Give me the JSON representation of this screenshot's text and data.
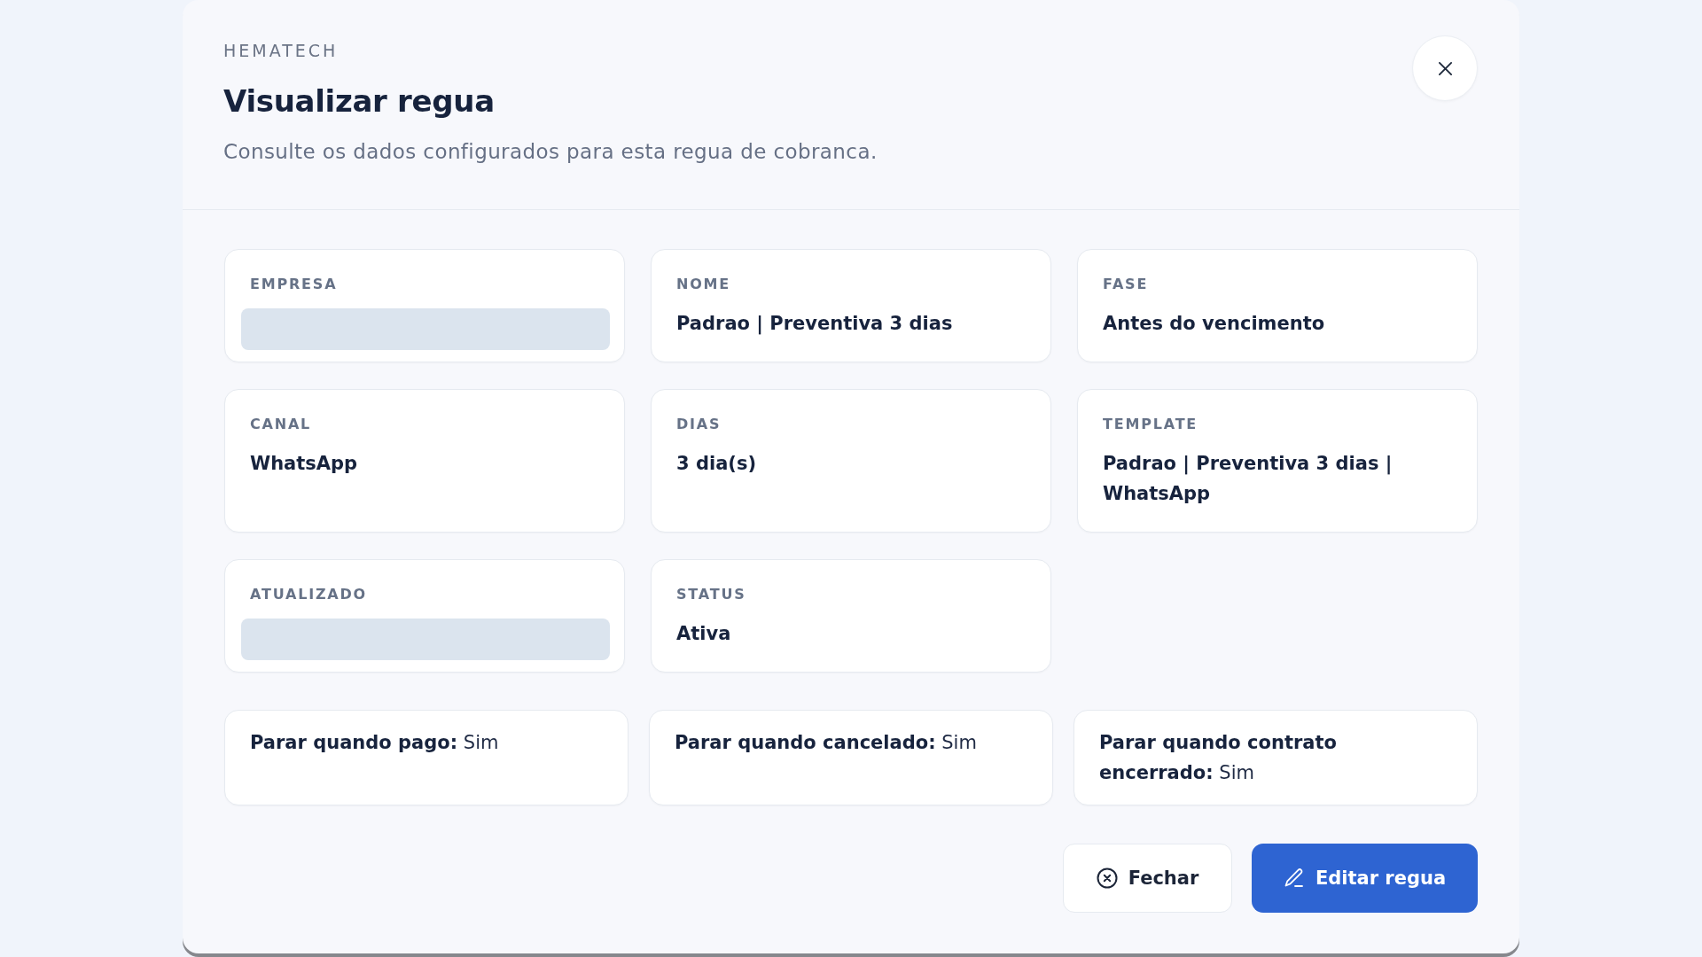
{
  "header": {
    "brand": "HEMATECH",
    "title": "Visualizar regua",
    "subtitle": "Consulte os dados configurados para esta regua de cobranca."
  },
  "fields": [
    {
      "kind": "masked",
      "label": "EMPRESA"
    },
    {
      "kind": "text",
      "label": "NOME",
      "value": "Padrao | Preventiva 3 dias"
    },
    {
      "kind": "text",
      "label": "FASE",
      "value": "Antes do vencimento"
    },
    {
      "kind": "text",
      "label": "CANAL",
      "value": "WhatsApp"
    },
    {
      "kind": "text",
      "label": "DIAS",
      "value": "3 dia(s)"
    },
    {
      "kind": "text",
      "label": "TEMPLATE",
      "value": "Padrao | Preventiva 3 dias | WhatsApp"
    },
    {
      "kind": "masked",
      "label": "ATUALIZADO"
    },
    {
      "kind": "text",
      "label": "STATUS",
      "value": "Ativa"
    }
  ],
  "stop_rules": [
    {
      "label": "Parar quando pago:",
      "value": "Sim"
    },
    {
      "label": "Parar quando cancelado:",
      "value": "Sim"
    },
    {
      "label": "Parar quando contrato encerrado:",
      "value": "Sim"
    }
  ],
  "buttons": [
    {
      "kind": "secondary",
      "label": "Fechar"
    },
    {
      "kind": "primary",
      "label": "Editar regua"
    }
  ]
}
